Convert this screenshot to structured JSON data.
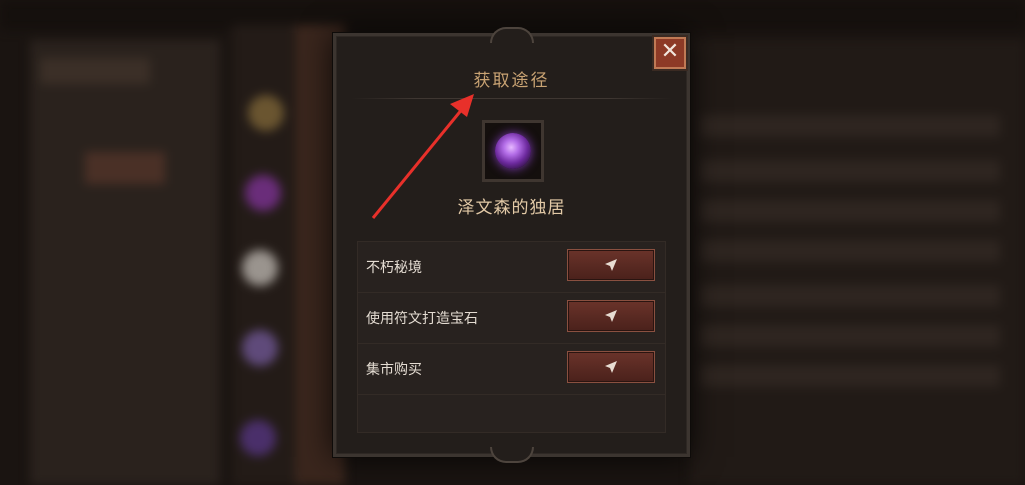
{
  "dialog": {
    "title": "获取途径",
    "close_label": "✕",
    "item": {
      "name": "泽文森的独居",
      "icon": "purple-gem-icon"
    },
    "sources": [
      {
        "label": "不朽秘境",
        "action_icon": "navigate-arrow-icon"
      },
      {
        "label": "使用符文打造宝石",
        "action_icon": "navigate-arrow-icon"
      },
      {
        "label": "集市购买",
        "action_icon": "navigate-arrow-icon"
      }
    ]
  },
  "colors": {
    "title": "#c9a373",
    "close_button": "#8d3a26",
    "action_button": "#6a332a",
    "annotation_arrow": "#e8302a"
  }
}
